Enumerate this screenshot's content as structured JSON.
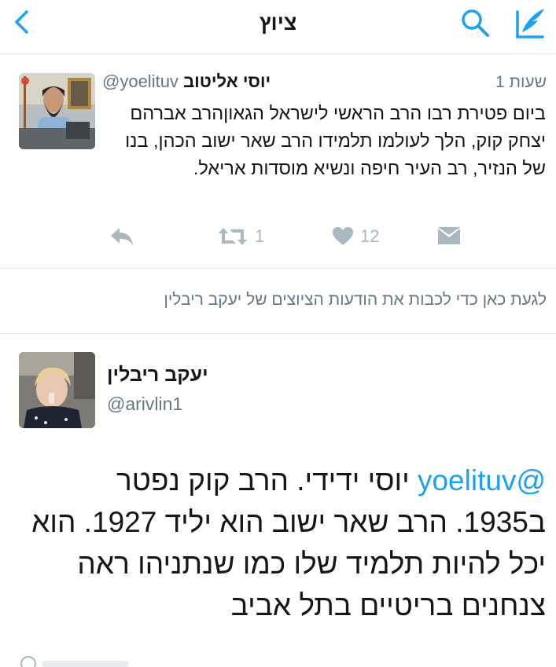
{
  "header": {
    "title": "ציוץ",
    "icons": {
      "back": "chevron-left-icon",
      "search": "search-icon",
      "compose": "compose-icon"
    },
    "accent": "#1da1f2"
  },
  "tweet1": {
    "author_name": "יוסי אליטוב",
    "author_handle": "@yoelituv",
    "time": "1 שעות",
    "text": "ביום פטירת רבו הרב הראשי לישראל הגאוןהרב אברהם יצחק קוק, הלך לעולמו תלמידו הרב שאר ישוב הכהן, בנו של הנזיר, רב העיר חיפה ונשיא מוסדות אריאל.",
    "retweets": "1",
    "likes": "12"
  },
  "notice": {
    "text": "לגעת כאן כדי לכבות את הודעות הציוצים של יעקב ריבלין"
  },
  "tweet2": {
    "author_name": "יעקב ריבלין",
    "author_handle": "@arivlin1",
    "mention": "@yoelituv",
    "text": "יוסי ידידי. הרב קוק נפטר ב1935. הרב שאר ישוב הוא יליד 1927. הוא יכל להיות תלמיד שלו כמו שנתניהו ראה צנחנים בריטיים בתל אביב"
  },
  "colors": {
    "secondary_text": "#657786",
    "action_gray": "#aab8c2",
    "divider": "#e1e8ed"
  }
}
